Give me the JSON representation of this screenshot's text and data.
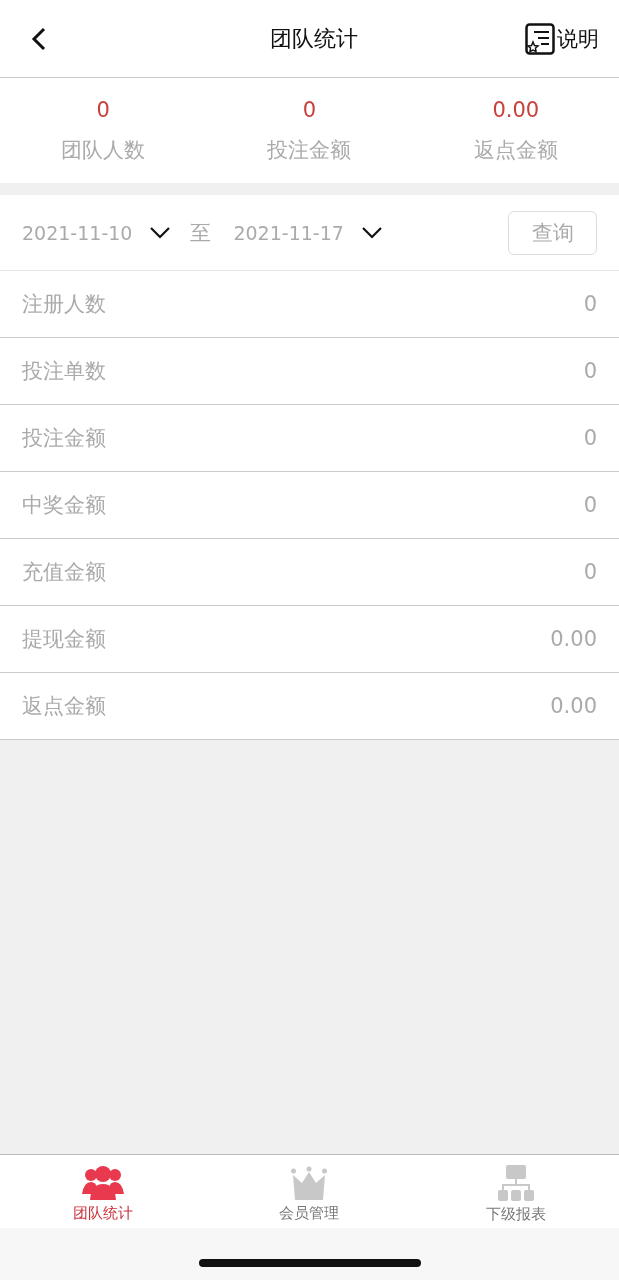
{
  "header": {
    "title": "团队统计",
    "help_label": "说明"
  },
  "summary": [
    {
      "value": "0",
      "label": "团队人数"
    },
    {
      "value": "0",
      "label": "投注金额"
    },
    {
      "value": "0.00",
      "label": "返点金额"
    }
  ],
  "filter": {
    "start_date": "2021-11-10",
    "separator": "至",
    "end_date": "2021-11-17",
    "query_button": "查询"
  },
  "stats": [
    {
      "label": "注册人数",
      "value": "0"
    },
    {
      "label": "投注单数",
      "value": "0"
    },
    {
      "label": "投注金额",
      "value": "0"
    },
    {
      "label": "中奖金额",
      "value": "0"
    },
    {
      "label": "充值金额",
      "value": "0"
    },
    {
      "label": "提现金额",
      "value": "0.00"
    },
    {
      "label": "返点金额",
      "value": "0.00"
    }
  ],
  "tabs": [
    {
      "label": "团队统计",
      "kind": "team",
      "selected": true
    },
    {
      "label": "会员管理",
      "kind": "crown",
      "selected": false
    },
    {
      "label": "下级报表",
      "kind": "org",
      "selected": false
    }
  ]
}
